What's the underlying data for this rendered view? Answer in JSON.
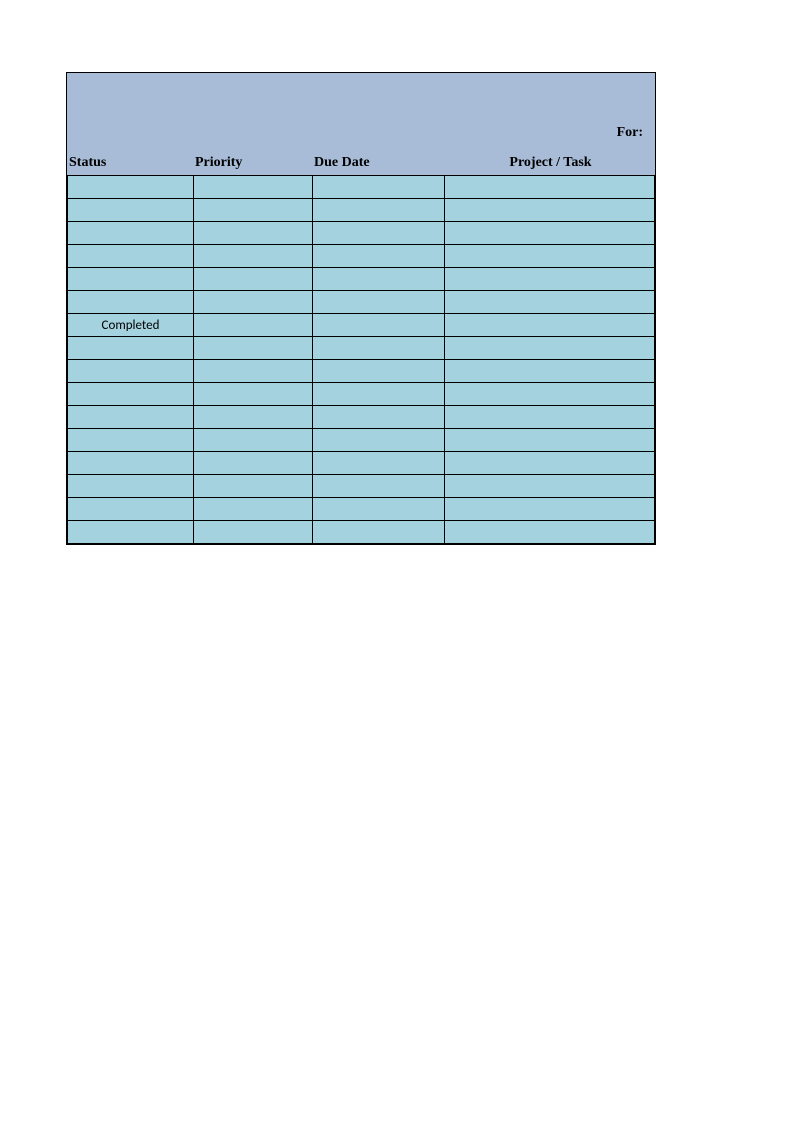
{
  "header": {
    "for_label": "For:"
  },
  "columns": {
    "status": "Status",
    "priority": "Priority",
    "due_date": "Due Date",
    "project_task": "Project / Task"
  },
  "rows": [
    {
      "status": "",
      "priority": "",
      "due_date": "",
      "project_task": ""
    },
    {
      "status": "",
      "priority": "",
      "due_date": "",
      "project_task": ""
    },
    {
      "status": "",
      "priority": "",
      "due_date": "",
      "project_task": ""
    },
    {
      "status": "",
      "priority": "",
      "due_date": "",
      "project_task": ""
    },
    {
      "status": "",
      "priority": "",
      "due_date": "",
      "project_task": ""
    },
    {
      "status": "",
      "priority": "",
      "due_date": "",
      "project_task": ""
    },
    {
      "status": "Completed",
      "priority": "",
      "due_date": "",
      "project_task": ""
    },
    {
      "status": "",
      "priority": "",
      "due_date": "",
      "project_task": ""
    },
    {
      "status": "",
      "priority": "",
      "due_date": "",
      "project_task": ""
    },
    {
      "status": "",
      "priority": "",
      "due_date": "",
      "project_task": ""
    },
    {
      "status": "",
      "priority": "",
      "due_date": "",
      "project_task": ""
    },
    {
      "status": "",
      "priority": "",
      "due_date": "",
      "project_task": ""
    },
    {
      "status": "",
      "priority": "",
      "due_date": "",
      "project_task": ""
    },
    {
      "status": "",
      "priority": "",
      "due_date": "",
      "project_task": ""
    },
    {
      "status": "",
      "priority": "",
      "due_date": "",
      "project_task": ""
    },
    {
      "status": "",
      "priority": "",
      "due_date": "",
      "project_task": ""
    }
  ]
}
